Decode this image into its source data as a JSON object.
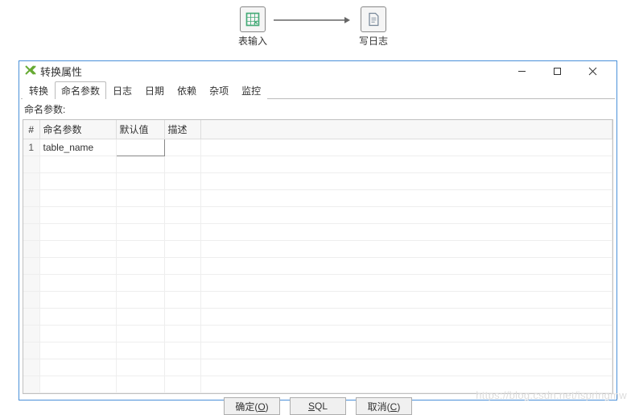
{
  "canvas": {
    "step1": {
      "label": "表输入"
    },
    "step2": {
      "label": "写日志"
    }
  },
  "dialog": {
    "title": "转换属性",
    "tabs": [
      "转换",
      "命名参数",
      "日志",
      "日期",
      "依赖",
      "杂项",
      "监控"
    ],
    "active_tab_index": 1,
    "section_label": "命名参数:",
    "columns": {
      "hash": "#",
      "name": "命名参数",
      "default": "默认值",
      "desc": "描述"
    },
    "rows": [
      {
        "num": "1",
        "name": "table_name",
        "default": "",
        "desc": ""
      }
    ],
    "buttons": {
      "ok": "确定(O)",
      "sql": "SQL",
      "cancel": "取消(C)"
    }
  },
  "watermark": "https://blog.csdn.net/ispringmw"
}
